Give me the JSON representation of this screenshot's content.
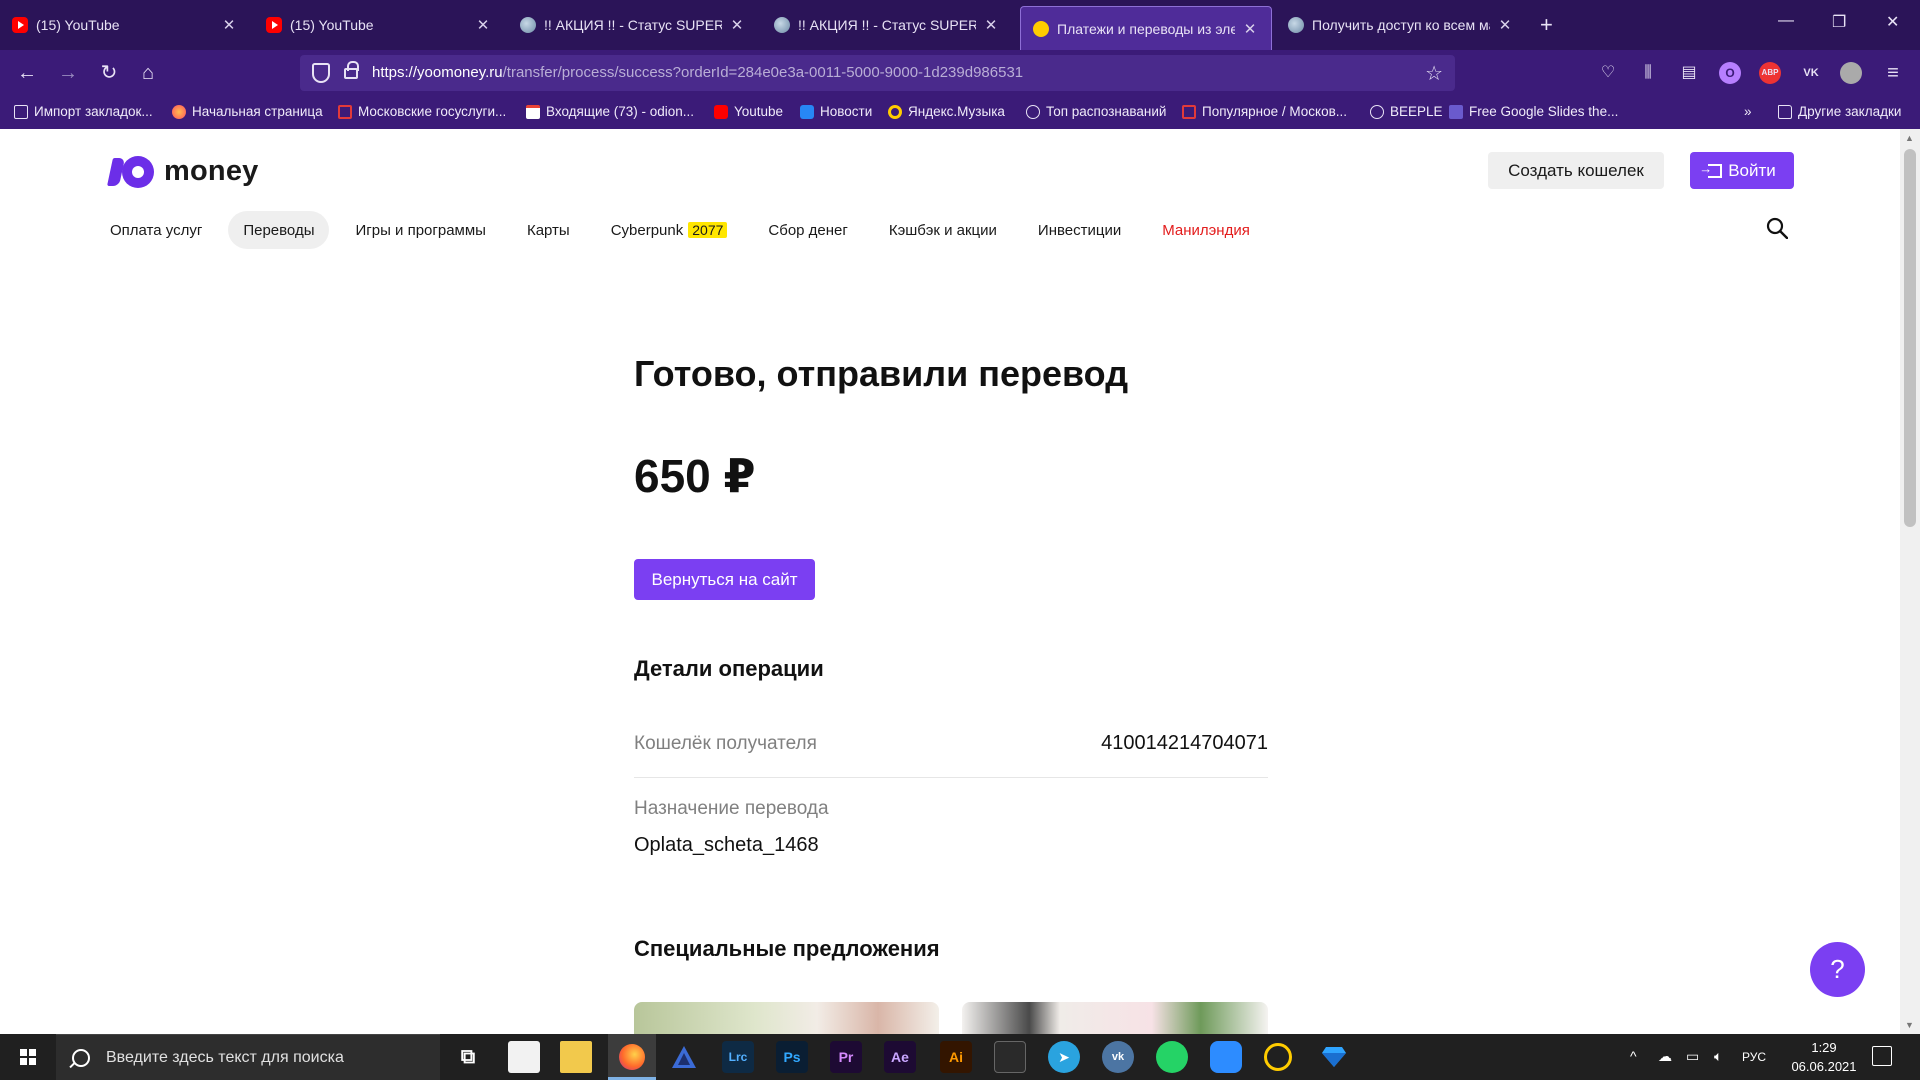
{
  "browser": {
    "tabs": [
      {
        "title": "(15) YouTube",
        "icon": "youtube-icon"
      },
      {
        "title": "(15) YouTube",
        "icon": "youtube-icon"
      },
      {
        "title": "!! АКЦИЯ !! - Статус SUPER VIP",
        "icon": "image-icon"
      },
      {
        "title": "!! АКЦИЯ !! - Статус SUPER VIP",
        "icon": "image-icon"
      },
      {
        "title": "Платежи и переводы из электр",
        "icon": "yoomoney-icon"
      },
      {
        "title": "Получить доступ ко всем мат",
        "icon": "image-icon"
      }
    ],
    "new_tab": "+",
    "url_host": "https://yoomoney.ru",
    "url_path": "/transfer/process/success?orderId=284e0e3a-0011-5000-9000-1d239d986531",
    "bookmarks": [
      "Импорт закладок...",
      "Начальная страница",
      "Московские госуслуги...",
      "Входящие (73) - odion...",
      "Youtube",
      "Новости",
      "Яндекс.Музыка",
      "Топ распознаваний",
      "Популярное / Москов...",
      "BEEPLE",
      "Free Google Slides the...",
      "Другие закладки"
    ],
    "ext_abp": "ABP",
    "ext_vk": "VK"
  },
  "site": {
    "logo_text": "money",
    "create_wallet": "Создать кошелек",
    "login": "Войти",
    "nav": [
      "Оплата услуг",
      "Переводы",
      "Игры и программы",
      "Карты",
      "Cyberpunk",
      "Сбор денег",
      "Кэшбэк и акции",
      "Инвестиции",
      "Манилэндия"
    ],
    "nav_badge": "2077"
  },
  "main": {
    "title": "Готово, отправили перевод",
    "amount": "650 ₽",
    "back_button": "Вернуться на сайт",
    "details_title": "Детали операции",
    "wallet_label": "Кошелёк получателя",
    "wallet_value": "410014214704071",
    "purpose_label": "Назначение перевода",
    "purpose_value": "Oplata_scheta_1468",
    "offers_title": "Специальные предложения",
    "help": "?"
  },
  "taskbar": {
    "search_placeholder": "Введите здесь текст для поиска",
    "apps": [
      "Lrc",
      "Ps",
      "Pr",
      "Ae",
      "Ai"
    ],
    "lang": "РУС",
    "time": "1:29",
    "date": "06.06.2021"
  },
  "colors": {
    "accent": "#7b3ff2",
    "chrome": "#3b1b78",
    "tabbar": "#2b1458"
  }
}
